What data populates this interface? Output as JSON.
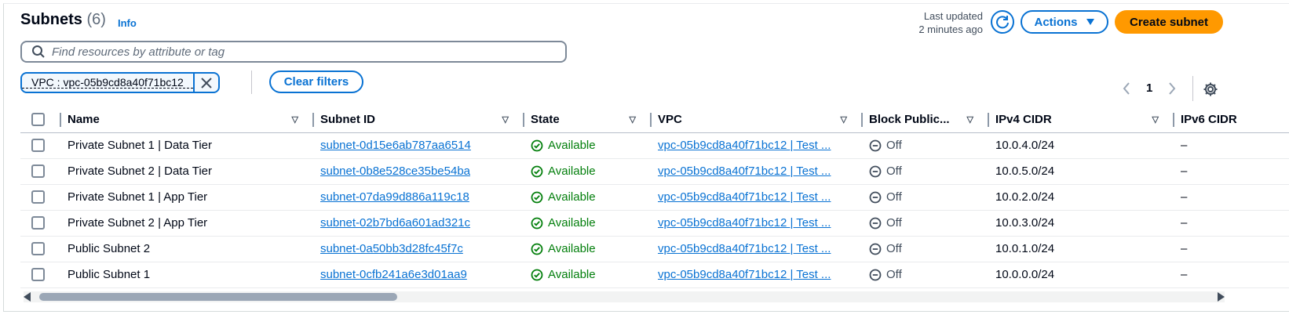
{
  "header": {
    "title": "Subnets",
    "count": "(6)",
    "info": "Info",
    "last_updated_line1": "Last updated",
    "last_updated_line2": "2 minutes ago",
    "actions_label": "Actions",
    "create_label": "Create subnet"
  },
  "search": {
    "placeholder": "Find resources by attribute or tag"
  },
  "filter_token": {
    "label": "VPC : vpc-05b9cd8a40f71bc12"
  },
  "clear_filters_label": "Clear filters",
  "pagination": {
    "current_page": "1"
  },
  "table": {
    "columns": [
      "Name",
      "Subnet ID",
      "State",
      "VPC",
      "Block Public...",
      "IPv4 CIDR",
      "IPv6 CIDR"
    ],
    "rows": [
      {
        "name": "Private Subnet 1 | Data Tier",
        "subnet_id": "subnet-0d15e6ab787aa6514",
        "state": "Available",
        "vpc": "vpc-05b9cd8a40f71bc12 | Test ...",
        "block_public": "Off",
        "ipv4": "10.0.4.0/24",
        "ipv6": "–"
      },
      {
        "name": "Private Subnet 2 | Data Tier",
        "subnet_id": "subnet-0b8e528ce35be54ba",
        "state": "Available",
        "vpc": "vpc-05b9cd8a40f71bc12 | Test ...",
        "block_public": "Off",
        "ipv4": "10.0.5.0/24",
        "ipv6": "–"
      },
      {
        "name": "Private Subnet 1 | App Tier",
        "subnet_id": "subnet-07da99d886a119c18",
        "state": "Available",
        "vpc": "vpc-05b9cd8a40f71bc12 | Test ...",
        "block_public": "Off",
        "ipv4": "10.0.2.0/24",
        "ipv6": "–"
      },
      {
        "name": "Private Subnet 2 | App Tier",
        "subnet_id": "subnet-02b7bd6a601ad321c",
        "state": "Available",
        "vpc": "vpc-05b9cd8a40f71bc12 | Test ...",
        "block_public": "Off",
        "ipv4": "10.0.3.0/24",
        "ipv6": "–"
      },
      {
        "name": "Public Subnet 2",
        "subnet_id": "subnet-0a50bb3d28fc45f7c",
        "state": "Available",
        "vpc": "vpc-05b9cd8a40f71bc12 | Test ...",
        "block_public": "Off",
        "ipv4": "10.0.1.0/24",
        "ipv6": "–"
      },
      {
        "name": "Public Subnet 1",
        "subnet_id": "subnet-0cfb241a6e3d01aa9",
        "state": "Available",
        "vpc": "vpc-05b9cd8a40f71bc12 | Test ...",
        "block_public": "Off",
        "ipv4": "10.0.0.0/24",
        "ipv6": "–"
      }
    ]
  },
  "colors": {
    "link": "#0972d3",
    "primary_button": "#ff9900",
    "available": "#037f0c"
  },
  "icons": [
    "search-icon",
    "refresh-icon",
    "caret-down-icon",
    "close-icon",
    "chevron-left-icon",
    "chevron-right-icon",
    "gear-icon",
    "status-check-icon",
    "status-off-icon"
  ]
}
